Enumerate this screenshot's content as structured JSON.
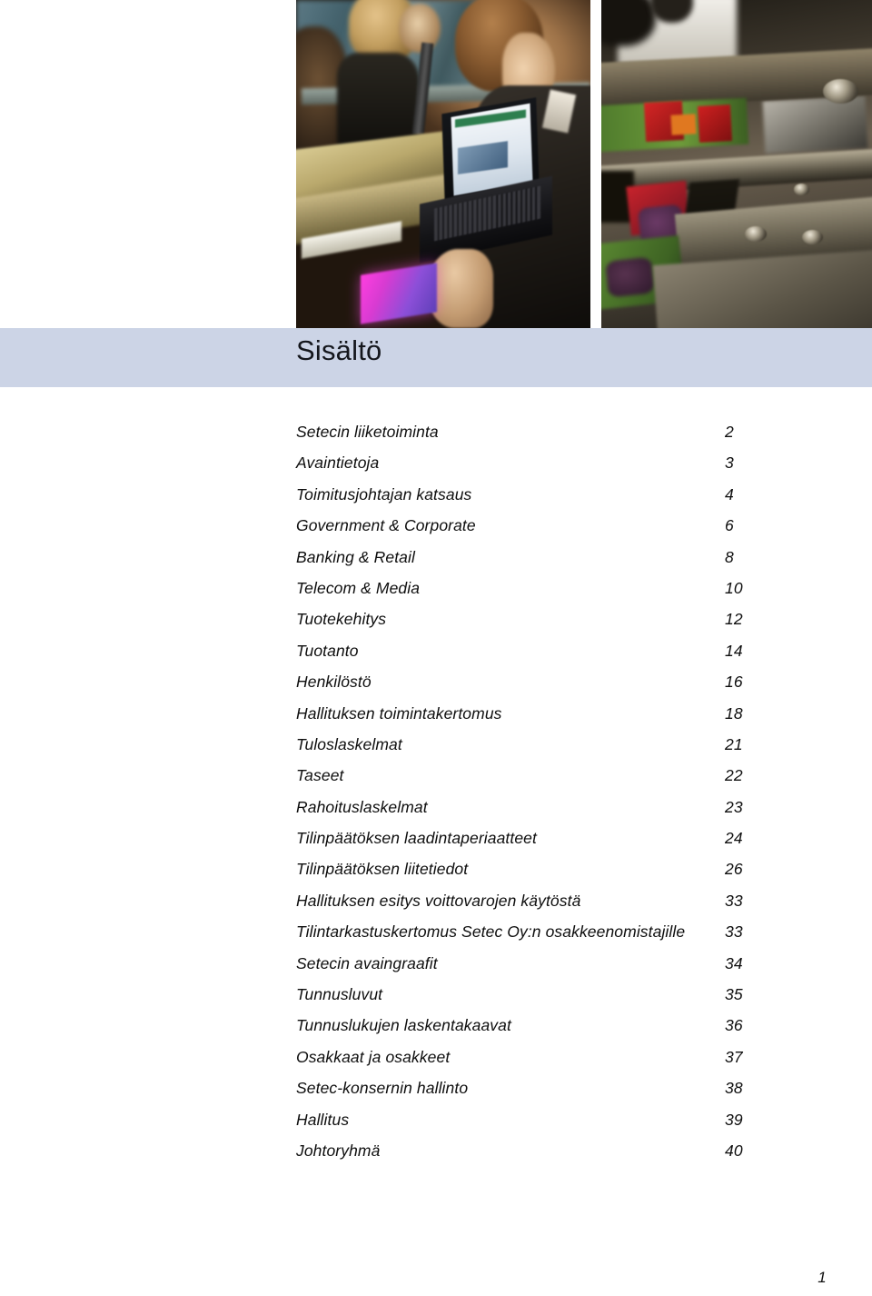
{
  "page": {
    "title": "Sisältö",
    "folio": "1",
    "band_color": "#ccd4e6",
    "background_color": "#ffffff",
    "text_color": "#0e0e0e"
  },
  "photos": [
    {
      "name": "service-counter-photo",
      "description": "Man in dark suit at a service counter using a laptop and holding a purple card"
    },
    {
      "name": "card-printing-machinery-photo",
      "description": "Close-up of card personalisation machinery with red and green printed cards"
    }
  ],
  "toc": {
    "entries": [
      {
        "label": "Setecin liiketoiminta",
        "page": "2"
      },
      {
        "label": "Avaintietoja",
        "page": "3"
      },
      {
        "label": "Toimitusjohtajan katsaus",
        "page": "4"
      },
      {
        "label": "Government & Corporate",
        "page": "6"
      },
      {
        "label": "Banking & Retail",
        "page": "8"
      },
      {
        "label": "Telecom & Media",
        "page": "10"
      },
      {
        "label": "Tuotekehitys",
        "page": "12"
      },
      {
        "label": "Tuotanto",
        "page": "14"
      },
      {
        "label": "Henkilöstö",
        "page": "16"
      },
      {
        "label": "Hallituksen toimintakertomus",
        "page": "18"
      },
      {
        "label": "Tuloslaskelmat",
        "page": "21"
      },
      {
        "label": "Taseet",
        "page": "22"
      },
      {
        "label": "Rahoituslaskelmat",
        "page": "23"
      },
      {
        "label": "Tilinpäätöksen laadintaperiaatteet",
        "page": "24"
      },
      {
        "label": "Tilinpäätöksen liitetiedot",
        "page": "26"
      },
      {
        "label": "Hallituksen esitys voittovarojen käytöstä",
        "page": "33"
      },
      {
        "label": "Tilintarkastuskertomus Setec Oy:n osakkeenomistajille",
        "page": "33"
      },
      {
        "label": "Setecin avaingraafit",
        "page": "34"
      },
      {
        "label": "Tunnusluvut",
        "page": "35"
      },
      {
        "label": "Tunnuslukujen laskentakaavat",
        "page": "36"
      },
      {
        "label": "Osakkaat ja osakkeet",
        "page": "37"
      },
      {
        "label": "Setec-konsernin hallinto",
        "page": "38"
      },
      {
        "label": "Hallitus",
        "page": "39"
      },
      {
        "label": "Johtoryhmä",
        "page": "40"
      }
    ]
  }
}
